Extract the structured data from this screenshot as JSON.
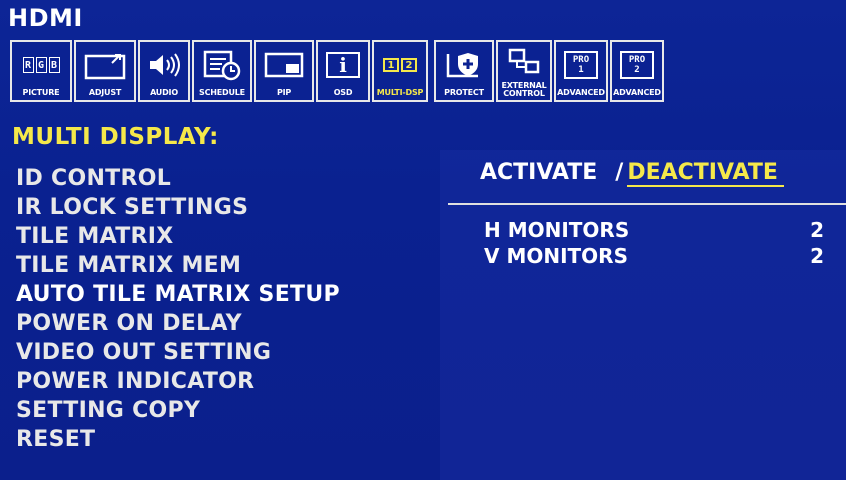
{
  "header": {
    "source": "HDMI"
  },
  "toolbar": {
    "tabs": [
      {
        "id": "picture",
        "label": "PICTURE",
        "icon": "rgb-icon"
      },
      {
        "id": "adjust",
        "label": "ADJUST",
        "icon": "adjust-icon"
      },
      {
        "id": "audio",
        "label": "AUDIO",
        "icon": "speaker-icon"
      },
      {
        "id": "schedule",
        "label": "SCHEDULE",
        "icon": "schedule-icon"
      },
      {
        "id": "pip",
        "label": "PIP",
        "icon": "pip-icon"
      },
      {
        "id": "osd",
        "label": "OSD",
        "icon": "info-icon"
      },
      {
        "id": "multidsp",
        "label": "MULTI-DSP",
        "icon": "multi-display-icon"
      },
      {
        "id": "protect",
        "label": "PROTECT",
        "icon": "shield-icon"
      },
      {
        "id": "external",
        "label_line1": "EXTERNAL",
        "label_line2": "CONTROL",
        "icon": "external-control-icon"
      },
      {
        "id": "adv1",
        "label": "ADVANCED",
        "icon": "pro1-icon"
      },
      {
        "id": "adv2",
        "label": "ADVANCED",
        "icon": "pro2-icon"
      }
    ],
    "rgb": [
      "R",
      "G",
      "B"
    ],
    "multi_nums": [
      "1",
      "2"
    ],
    "pro": "PRO",
    "pro1_num": "1",
    "pro2_num": "2",
    "info_glyph": "i",
    "speaker_glyph": "🔊"
  },
  "section": {
    "title": "MULTI DISPLAY:"
  },
  "menu": {
    "items": [
      "ID CONTROL",
      "IR LOCK SETTINGS",
      "TILE MATRIX",
      "TILE MATRIX MEM",
      "AUTO TILE MATRIX SETUP",
      "POWER ON DELAY",
      "VIDEO OUT SETTING",
      "POWER INDICATOR",
      "SETTING COPY",
      "RESET"
    ]
  },
  "detail": {
    "activate": "ACTIVATE",
    "slash": "/",
    "deactivate": "DEACTIVATE",
    "h_monitors_label": "H MONITORS",
    "h_monitors_value": "2",
    "v_monitors_label": "V MONITORS",
    "v_monitors_value": "2"
  },
  "colors": {
    "background": "#0a1e8a",
    "highlight": "#f5e84a",
    "text": "#ffffff"
  }
}
